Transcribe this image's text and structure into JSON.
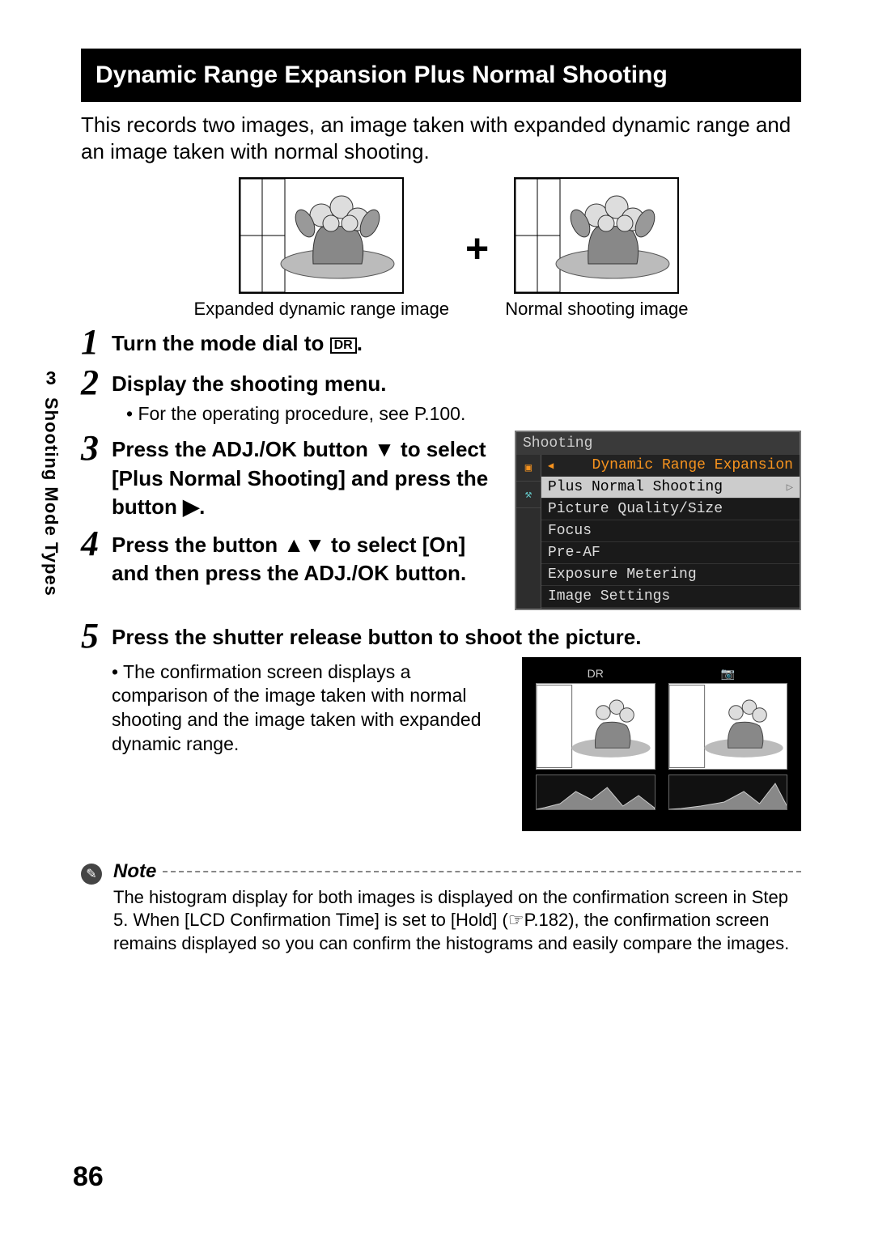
{
  "section_title": "Dynamic Range Expansion Plus Normal Shooting",
  "intro": "This records two images, an image taken with expanded dynamic range and an image taken with normal shooting.",
  "caption_left": "Expanded dynamic range image",
  "caption_right": "Normal shooting image",
  "plus_sign": "+",
  "sidebar": {
    "chapter_number": "3",
    "label": "Shooting Mode Types"
  },
  "steps": [
    {
      "num": "1",
      "title_prefix": "Turn the mode dial to ",
      "dr_label": "DR",
      "title_suffix": "."
    },
    {
      "num": "2",
      "title": "Display the shooting menu.",
      "bullet": "For the operating procedure, see P.100."
    },
    {
      "num": "3",
      "title": "Press the ADJ./OK button ▼ to select [Plus Normal Shooting] and press the button ▶."
    },
    {
      "num": "4",
      "title": "Press the button ▲▼ to select [On] and then press the ADJ./OK button."
    },
    {
      "num": "5",
      "title": "Press the shutter release button to shoot the picture.",
      "bullet": "The confirmation screen displays a comparison of the image taken with normal shooting and the image taken with expanded dynamic range."
    }
  ],
  "menu": {
    "title": "Shooting",
    "header": "Dynamic Range Expansion",
    "selected": "Plus Normal Shooting",
    "items": [
      "Picture Quality/Size",
      "Focus",
      "Pre-AF",
      "Exposure Metering",
      "Image Settings"
    ]
  },
  "confirm_icons": {
    "left": "DR",
    "right": "📷"
  },
  "note": {
    "label": "Note",
    "text_1": "The histogram display for both images is displayed on the confirmation screen in Step 5. When [LCD Confirmation Time] is set to [Hold] (",
    "ref": "☞P.182",
    "text_2": "), the confirmation screen remains displayed so you can confirm the histograms and easily compare the images."
  },
  "page_number": "86"
}
